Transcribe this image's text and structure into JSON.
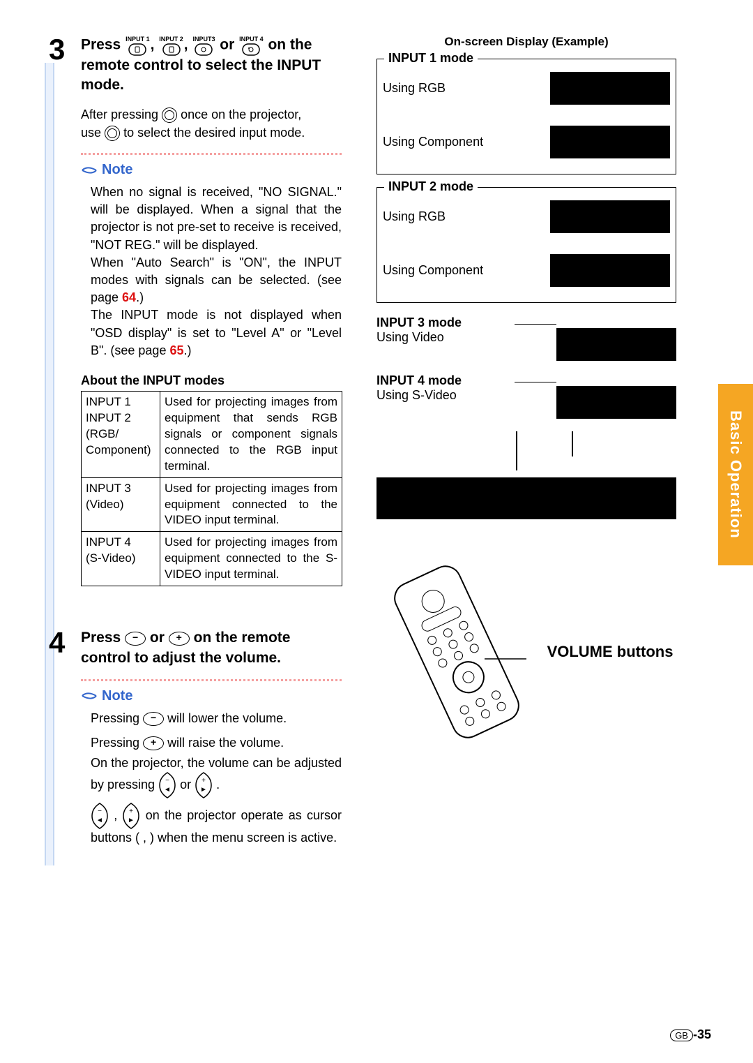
{
  "side_tab": "Basic Operation",
  "page_number_region": "GB",
  "page_number": "-35",
  "step3": {
    "num": "3",
    "title_prefix": "Press",
    "input_labels": [
      "INPUT 1",
      "INPUT 2",
      "INPUT3",
      "INPUT 4"
    ],
    "title_suffix": "on the remote control to select the INPUT mode.",
    "after_press_a": "After pressing",
    "after_press_b": "once on the projector,",
    "after_press_c": "use",
    "after_press_d": "to select the desired input mode.",
    "note_label": "Note",
    "note_p1": "When no signal is received, \"NO SIGNAL.\" will be displayed. When a signal that the projector is not pre-set to receive is received, \"NOT REG.\" will be displayed.",
    "note_p2_a": "When \"Auto Search\" is \"ON\", the INPUT modes with signals can be selected. (see page ",
    "xref1": "64",
    "note_p2_b": ".)",
    "note_p3_a": "The INPUT mode is not displayed when \"OSD display\" is set to \"Level A\" or \"Level B\". (see page ",
    "xref2": "65",
    "note_p3_b": ".)",
    "table_head": "About the INPUT modes",
    "table": [
      {
        "c1": "INPUT 1\nINPUT 2\n(RGB/\nComponent)",
        "c2": "Used for projecting images from equipment that sends RGB signals or component signals connected to the RGB input terminal."
      },
      {
        "c1": "INPUT 3\n(Video)",
        "c2": "Used for projecting images from equipment connected to the VIDEO input terminal."
      },
      {
        "c1": "INPUT 4\n(S-Video)",
        "c2": "Used for projecting images from equipment connected to the S-VIDEO input terminal."
      }
    ]
  },
  "step4": {
    "num": "4",
    "title_prefix": "Press",
    "title_middle": "or",
    "title_suffix": "on the remote control to adjust the volume.",
    "note_label": "Note",
    "line1_a": "Pressing",
    "line1_b": "will lower the volume.",
    "line2_a": "Pressing",
    "line2_b": "will raise the volume.",
    "line3": "On the projector, the volume can be adjusted by pressing",
    "line3_mid": "or",
    "line3_end": ".",
    "line4_a": ",",
    "line4_b": "on the projector operate as cursor buttons (   ,   ) when the menu screen is active."
  },
  "osd": {
    "title": "On-screen Display (Example)",
    "mode1": {
      "legend": "INPUT 1 mode",
      "row1": "Using RGB",
      "row2": "Using Component"
    },
    "mode2": {
      "legend": "INPUT 2 mode",
      "row1": "Using RGB",
      "row2": "Using Component"
    },
    "mode3": {
      "head": "INPUT 3 mode",
      "sub": "Using Video"
    },
    "mode4": {
      "head": "INPUT 4 mode",
      "sub": "Using S-Video"
    }
  },
  "remote_label": "VOLUME buttons"
}
